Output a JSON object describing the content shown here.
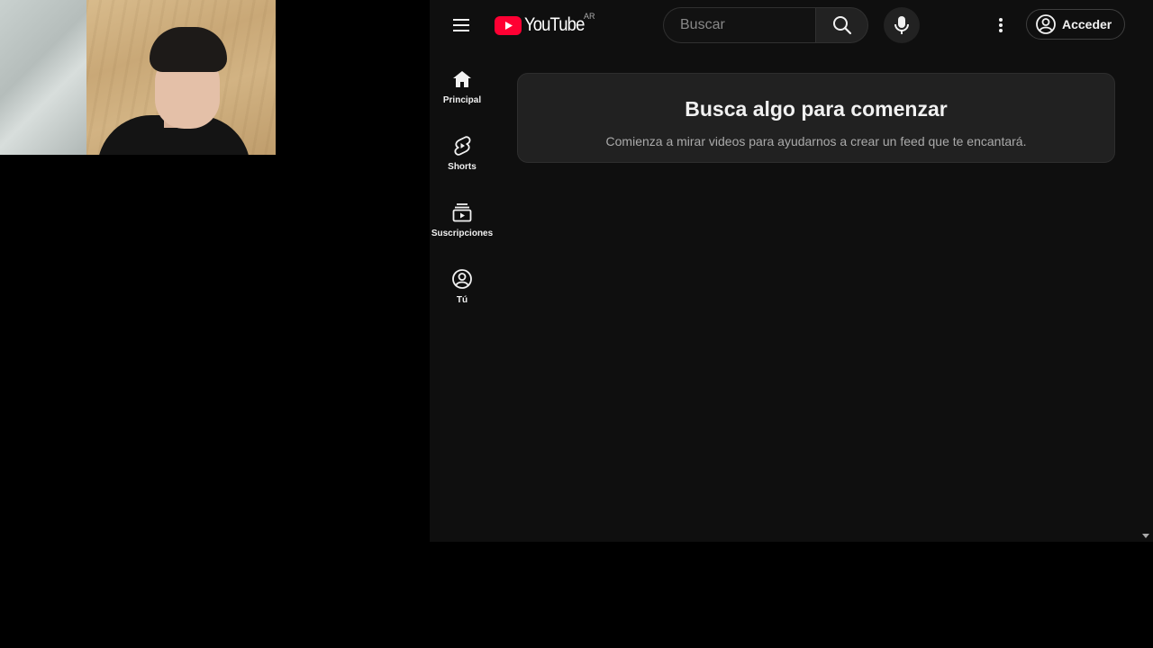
{
  "header": {
    "logo_text": "YouTube",
    "country_code": "AR",
    "search_placeholder": "Buscar",
    "signin_label": "Acceder"
  },
  "sidebar": {
    "items": [
      {
        "label": "Principal",
        "icon": "home-icon"
      },
      {
        "label": "Shorts",
        "icon": "shorts-icon"
      },
      {
        "label": "Suscripciones",
        "icon": "subscriptions-icon"
      },
      {
        "label": "Tú",
        "icon": "account-icon"
      }
    ]
  },
  "main": {
    "banner_title": "Busca algo para comenzar",
    "banner_subtitle": "Comienza a mirar videos para ayudarnos a crear un feed que te encantará."
  },
  "colors": {
    "background": "#0f0f0f",
    "brand_red": "#ff0033",
    "text": "#f1f1f1",
    "muted_text": "#aaaaaa"
  }
}
